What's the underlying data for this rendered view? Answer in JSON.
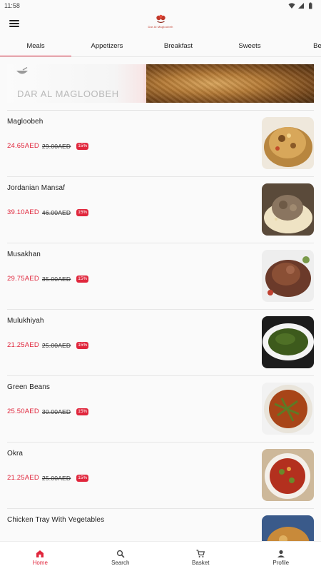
{
  "status_bar": {
    "time": "11:58"
  },
  "header": {
    "logo_text": "Dar Al Magloobeh"
  },
  "tabs": [
    {
      "label": "Meals",
      "active": true
    },
    {
      "label": "Appetizers",
      "active": false
    },
    {
      "label": "Breakfast",
      "active": false
    },
    {
      "label": "Sweets",
      "active": false
    },
    {
      "label": "Beve",
      "active": false
    }
  ],
  "banner": {
    "title": "DAR AL MAGLOOBEH",
    "subtitle": ""
  },
  "menu_items": [
    {
      "name": "Magloobeh",
      "price": "24.65AED",
      "old_price": "29.00AED",
      "discount": "15%"
    },
    {
      "name": "Jordanian Mansaf",
      "price": "39.10AED",
      "old_price": "46.00AED",
      "discount": "15%"
    },
    {
      "name": "Musakhan",
      "price": "29.75AED",
      "old_price": "35.00AED",
      "discount": "15%"
    },
    {
      "name": "Mulukhiyah",
      "price": "21.25AED",
      "old_price": "25.00AED",
      "discount": "15%"
    },
    {
      "name": "Green Beans",
      "price": "25.50AED",
      "old_price": "30.00AED",
      "discount": "15%"
    },
    {
      "name": "Okra",
      "price": "21.25AED",
      "old_price": "25.00AED",
      "discount": "15%"
    },
    {
      "name": "Chicken Tray With Vegetables",
      "price": "",
      "old_price": "",
      "discount": ""
    }
  ],
  "bottom_nav": [
    {
      "label": "Home",
      "icon": "home-icon",
      "active": true
    },
    {
      "label": "Search",
      "icon": "search-icon",
      "active": false
    },
    {
      "label": "Basket",
      "icon": "basket-icon",
      "active": false
    },
    {
      "label": "Profile",
      "icon": "profile-icon",
      "active": false
    }
  ],
  "colors": {
    "accent": "#e0263c",
    "background": "#fafafa"
  }
}
